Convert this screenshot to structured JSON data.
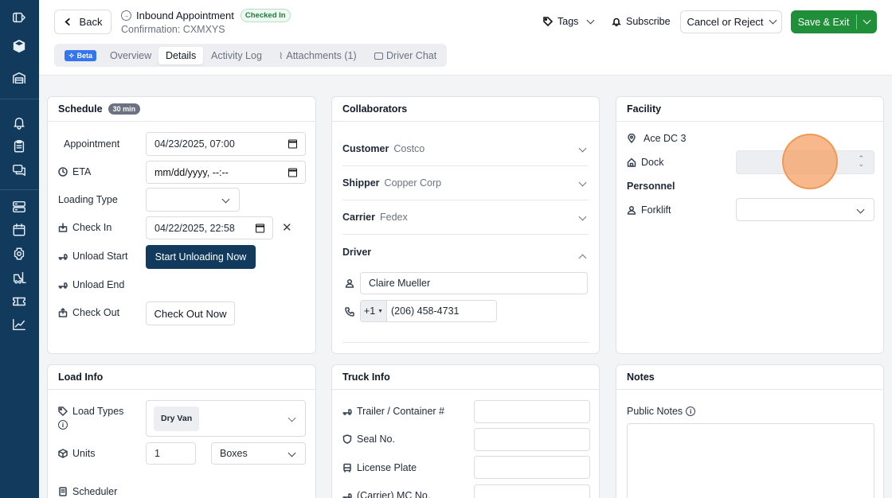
{
  "header": {
    "back_label": "Back",
    "title": "Inbound Appointment",
    "status_badge": "Checked In",
    "confirmation": "Confirmation: CXMXYS",
    "tags_label": "Tags",
    "subscribe_label": "Subscribe",
    "cancel_label": "Cancel or Reject",
    "save_label": "Save & Exit"
  },
  "tabs": {
    "beta_badge": "Beta",
    "items": [
      "Overview",
      "Details",
      "Activity Log",
      "Attachments (1)",
      "Driver Chat"
    ],
    "active": "Details"
  },
  "schedule": {
    "title": "Schedule",
    "duration_badge": "30 min",
    "appointment_label": "Appointment",
    "appointment_value": "04/23/2025, 07:00",
    "eta_label": "ETA",
    "eta_value": "mm/dd/yyyy, --:--",
    "loading_type_label": "Loading Type",
    "loading_type_value": "",
    "checkin_label": "Check In",
    "checkin_value": "04/22/2025, 22:58",
    "unload_start_label": "Unload Start",
    "start_unloading_btn": "Start Unloading Now",
    "unload_end_label": "Unload End",
    "checkout_label": "Check Out",
    "checkout_btn": "Check Out Now"
  },
  "collaborators": {
    "title": "Collaborators",
    "customer_label": "Customer",
    "customer_value": "Costco",
    "shipper_label": "Shipper",
    "shipper_value": "Copper Corp",
    "carrier_label": "Carrier",
    "carrier_value": "Fedex",
    "driver_label": "Driver",
    "driver_name": "Claire Mueller",
    "phone_code": "+1",
    "phone_number": "(206) 458-4731"
  },
  "facility": {
    "title": "Facility",
    "name": "Ace DC 3",
    "dock_label": "Dock",
    "dock_value": "",
    "personnel_title": "Personnel",
    "forklift_label": "Forklift",
    "forklift_value": ""
  },
  "load_info": {
    "title": "Load Info",
    "load_types_label": "Load Types",
    "load_type_tag": "Dry Van",
    "units_label": "Units",
    "units_value": "1",
    "units_type": "Boxes",
    "scheduler_label": "Scheduler"
  },
  "truck_info": {
    "title": "Truck Info",
    "trailer_label": "Trailer / Container #",
    "seal_label": "Seal No.",
    "plate_label": "License Plate",
    "mc_label": "(Carrier) MC No."
  },
  "notes": {
    "title": "Notes",
    "public_notes_label": "Public Notes"
  },
  "sidebar": {
    "icons": [
      "expand-sidebar-icon",
      "logo-icon",
      "warehouse-icon",
      "bell-icon",
      "clipboard-icon",
      "chat-icon",
      "server-icon",
      "calendar-icon",
      "settings-icon",
      "forklift-icon",
      "ticket-icon",
      "chart-icon"
    ]
  },
  "colors": {
    "sidebar": "#123a5c",
    "primary_button": "#123a5c",
    "save_button": "#1f8f3a",
    "beta_badge": "#3576f0"
  }
}
